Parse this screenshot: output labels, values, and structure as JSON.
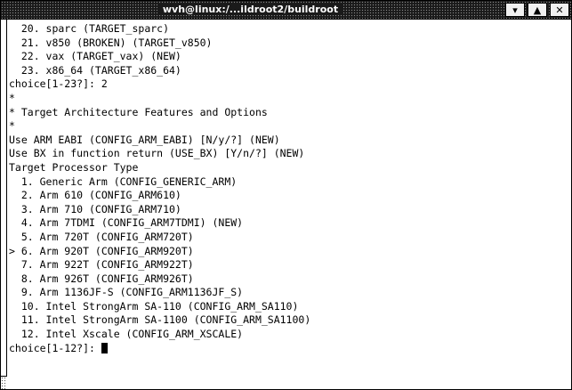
{
  "window": {
    "title": "wvh@linux:/...ildroot2/buildroot",
    "buttons": [
      {
        "name": "shade-button",
        "glyph": "▾"
      },
      {
        "name": "maximize-button",
        "glyph": "▲"
      },
      {
        "name": "close-button",
        "glyph": "✕"
      }
    ]
  },
  "terminal": {
    "lines": [
      "  20. sparc (TARGET_sparc)",
      "  21. v850 (BROKEN) (TARGET_v850)",
      "  22. vax (TARGET_vax) (NEW)",
      "  23. x86_64 (TARGET_x86_64)",
      "choice[1-23?]: 2",
      "*",
      "* Target Architecture Features and Options",
      "*",
      "Use ARM EABI (CONFIG_ARM_EABI) [N/y/?] (NEW)",
      "Use BX in function return (USE_BX) [Y/n/?] (NEW)",
      "Target Processor Type",
      "  1. Generic Arm (CONFIG_GENERIC_ARM)",
      "  2. Arm 610 (CONFIG_ARM610)",
      "  3. Arm 710 (CONFIG_ARM710)",
      "  4. Arm 7TDMI (CONFIG_ARM7TDMI) (NEW)",
      "  5. Arm 720T (CONFIG_ARM720T)",
      "> 6. Arm 920T (CONFIG_ARM920T)",
      "  7. Arm 922T (CONFIG_ARM922T)",
      "  8. Arm 926T (CONFIG_ARM926T)",
      "  9. Arm 1136JF-S (CONFIG_ARM1136JF_S)",
      "  10. Intel StrongArm SA-110 (CONFIG_ARM_SA110)",
      "  11. Intel StrongArm SA-1100 (CONFIG_ARM_SA1100)",
      "  12. Intel Xscale (CONFIG_ARM_XSCALE)"
    ],
    "prompt": "choice[1-12?]: "
  }
}
